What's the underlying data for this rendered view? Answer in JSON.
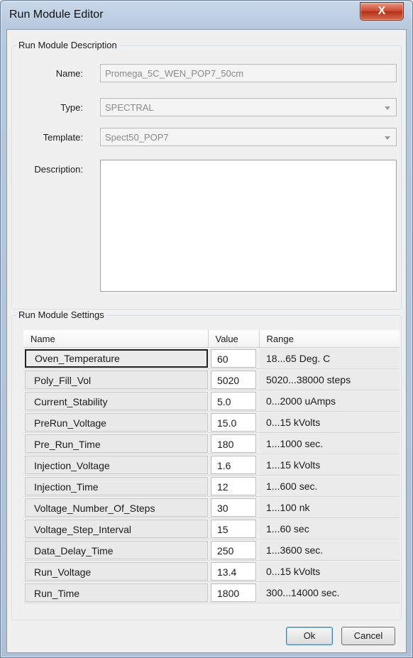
{
  "window": {
    "title": "Run Module Editor",
    "close_glyph": "X"
  },
  "description_group": {
    "label": "Run Module Description",
    "name_label": "Name:",
    "name_value": "Promega_5C_WEN_POP7_50cm",
    "type_label": "Type:",
    "type_value": "SPECTRAL",
    "template_label": "Template:",
    "template_value": "Spect50_POP7",
    "description_label": "Description:",
    "description_value": ""
  },
  "settings_group": {
    "label": "Run Module Settings",
    "columns": {
      "name": "Name",
      "value": "Value",
      "range": "Range"
    },
    "rows": [
      {
        "name": "Oven_Temperature",
        "value": "60",
        "range": "18...65 Deg. C"
      },
      {
        "name": "Poly_Fill_Vol",
        "value": "5020",
        "range": "5020...38000 steps"
      },
      {
        "name": "Current_Stability",
        "value": "5.0",
        "range": "0...2000 uAmps"
      },
      {
        "name": "PreRun_Voltage",
        "value": "15.0",
        "range": "0...15 kVolts"
      },
      {
        "name": "Pre_Run_Time",
        "value": "180",
        "range": "1...1000 sec."
      },
      {
        "name": "Injection_Voltage",
        "value": "1.6",
        "range": "1...15 kVolts"
      },
      {
        "name": "Injection_Time",
        "value": "12",
        "range": "1...600 sec."
      },
      {
        "name": "Voltage_Number_Of_Steps",
        "value": "30",
        "range": "1...100 nk"
      },
      {
        "name": "Voltage_Step_Interval",
        "value": "15",
        "range": "1...60 sec"
      },
      {
        "name": "Data_Delay_Time",
        "value": "250",
        "range": "1...3600 sec."
      },
      {
        "name": "Run_Voltage",
        "value": "13.4",
        "range": "0...15 kVolts"
      },
      {
        "name": "Run_Time",
        "value": "1800",
        "range": "300...14000 sec."
      }
    ]
  },
  "buttons": {
    "ok": "Ok",
    "cancel": "Cancel"
  }
}
